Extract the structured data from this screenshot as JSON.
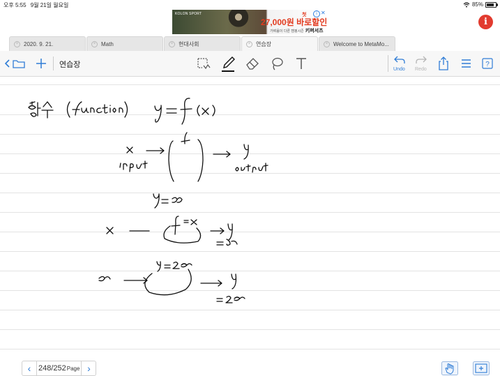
{
  "status_bar": {
    "time": "오후 5:55",
    "date": "9월 21일 월요일",
    "battery": "85%"
  },
  "ad": {
    "brand": "KOLON SPORT",
    "top_text": "첫",
    "headline": "27,000원 바로할인",
    "subtext": "가벼움이 다른 캠핑시즌",
    "product": "키퍼서츠",
    "info_icon": "info-icon",
    "close_label": "✕"
  },
  "info_button": {
    "label": "i",
    "color": "#e23b2f"
  },
  "tabs": [
    {
      "label": "2020. 9. 21."
    },
    {
      "label": "Math"
    },
    {
      "label": "현대사회"
    },
    {
      "label": "연습장"
    },
    {
      "label": "Welcome to MetaMo..."
    }
  ],
  "toolbar": {
    "document_title": "연습장",
    "undo_label": "Undo",
    "redo_label": "Redo",
    "icons": [
      "back-chevron-icon",
      "folder-icon",
      "plus-icon",
      "lasso-select-icon",
      "pen-icon",
      "eraser-icon",
      "lasso-icon",
      "text-icon",
      "undo-icon",
      "redo-icon",
      "share-icon",
      "list-icon",
      "help-icon"
    ]
  },
  "footer": {
    "page_number": "248/252",
    "page_suffix": "Page",
    "prev": "‹",
    "next": "›"
  },
  "accent_color": "#2f7cd6"
}
